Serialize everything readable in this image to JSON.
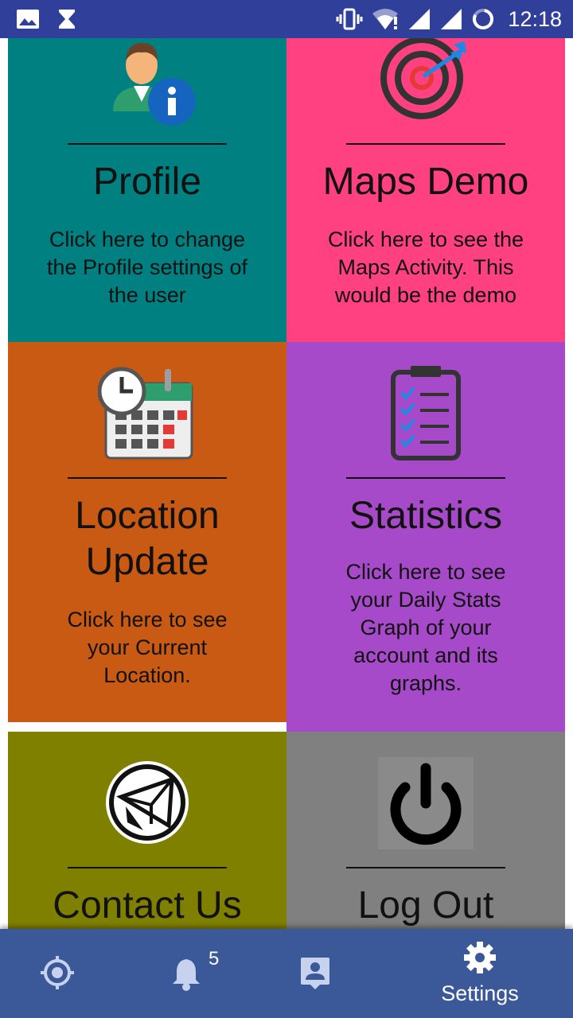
{
  "status_bar": {
    "time": "12:18",
    "icons": [
      "image-icon",
      "hourglass-icon",
      "vibrate-icon",
      "wifi-icon",
      "signal-icon",
      "signal-icon",
      "battery-icon"
    ]
  },
  "tiles": [
    {
      "id": "profile",
      "icon": "profile-info-icon",
      "title": "Profile",
      "description": "Click here to change the Profile settings of the user",
      "color": "#008080"
    },
    {
      "id": "maps",
      "icon": "target-icon",
      "title": "Maps Demo",
      "description": "Click here to see the Maps Activity. This would be the demo",
      "color": "#ff4081"
    },
    {
      "id": "location",
      "icon": "calendar-clock-icon",
      "title": "Location Update",
      "description": "Click here to see your Current Location.",
      "color": "#c85a14"
    },
    {
      "id": "stats",
      "icon": "checklist-icon",
      "title": "Statistics",
      "description": "Click here to see your Daily Stats Graph of your account and its graphs.",
      "color": "#a64ac9"
    },
    {
      "id": "contact",
      "icon": "mail-icon",
      "title": "Contact Us",
      "color": "#808000"
    },
    {
      "id": "logout",
      "icon": "power-icon",
      "title": "Log Out",
      "color": "#808080"
    }
  ],
  "bottom_nav": {
    "items": [
      {
        "icon": "location-target-icon",
        "label": ""
      },
      {
        "icon": "bell-icon",
        "label": "",
        "badge": "5"
      },
      {
        "icon": "contact-card-icon",
        "label": ""
      },
      {
        "icon": "gear-icon",
        "label": "Settings",
        "selected": true
      }
    ],
    "background": "#3b5998"
  }
}
